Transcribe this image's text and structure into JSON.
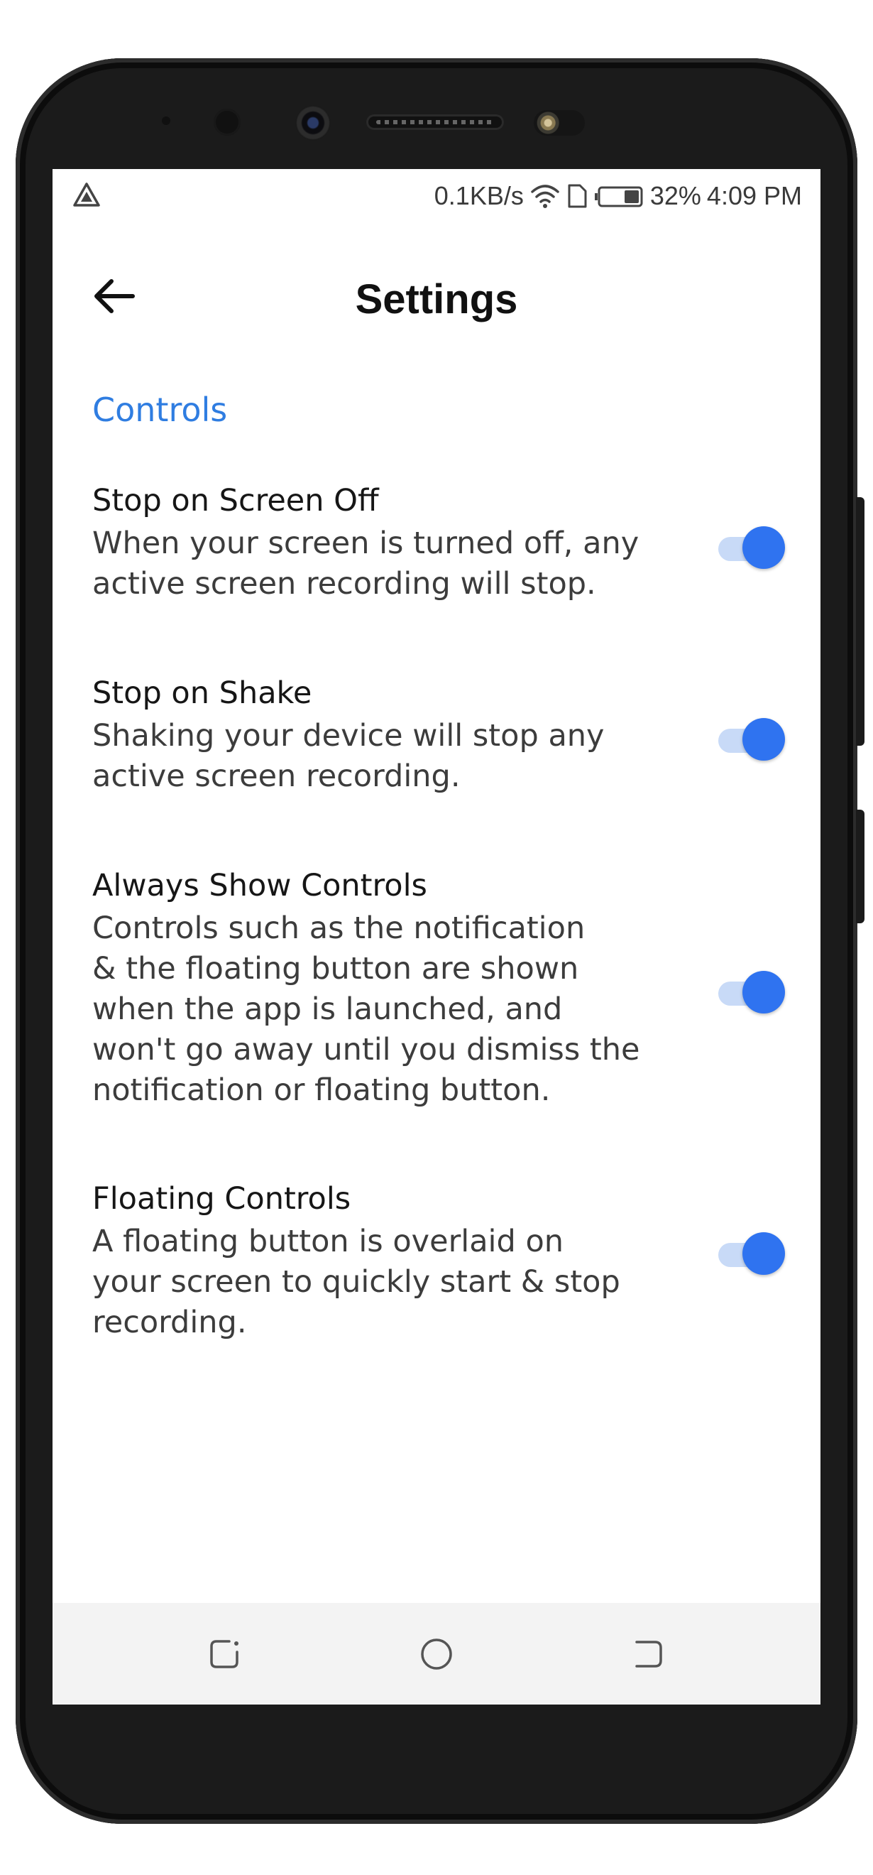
{
  "status_bar": {
    "speed": "0.1KB/s",
    "battery": "32%",
    "time": "4:09 PM",
    "icons": [
      "alert-triangle-icon",
      "wifi-icon",
      "sim-card-icon",
      "battery-icon"
    ]
  },
  "app_bar": {
    "title": "Settings",
    "back_icon": "arrow-left-icon"
  },
  "section": {
    "title": "Controls"
  },
  "settings": [
    {
      "title": "Stop on Screen Off",
      "description": "When your screen is turned off, any\nactive screen recording will stop.",
      "enabled": true
    },
    {
      "title": "Stop on Shake",
      "description": "Shaking your device will stop any\nactive screen recording.",
      "enabled": true
    },
    {
      "title": "Always Show Controls",
      "description": "Controls such as the notification\n& the floating button are shown\nwhen the app is launched, and\nwon't go away until you dismiss the\nnotification or floating button.",
      "enabled": true
    },
    {
      "title": "Floating Controls",
      "description": "A floating button is overlaid on\nyour screen to quickly start & stop\nrecording.",
      "enabled": true
    }
  ],
  "nav_bar": {
    "icons": [
      "recents-icon",
      "home-icon",
      "back-nav-icon"
    ]
  },
  "colors": {
    "accent": "#2f73f0",
    "section_header": "#2f7de1",
    "switch_track": "#c8daf7"
  }
}
